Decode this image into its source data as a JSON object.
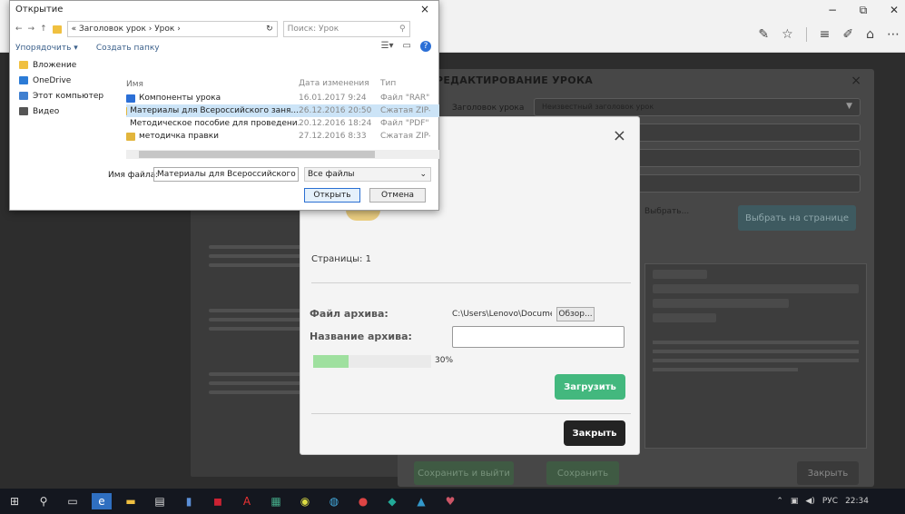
{
  "browser": {
    "win_min": "−",
    "win_restore": "⧉",
    "win_close": "✕"
  },
  "editor": {
    "title": "РЕДАКТИРОВАНИЕ УРОКА",
    "close": "×",
    "lesson_label": "Заголовок урока",
    "select_value": "Неизвестный заголовок урок",
    "choose_text": "Выбрать...",
    "choose_button": "Выбрать на странице",
    "btn_save": "Сохранить и выйти",
    "btn_save2": "Сохранить",
    "btn_close": "Закрыть"
  },
  "modal": {
    "close": "×",
    "pages": "Страницы: 1",
    "file_label": "Файл архива:",
    "file_path": "C:\\Users\\Lenovo\\Docume",
    "browse": "Обзор...",
    "name_label": "Название архива:",
    "name_value": "",
    "progress_percent": 30,
    "progress_text": "30%",
    "upload": "Загрузить",
    "close_button": "Закрыть"
  },
  "file_dialog": {
    "title": "Открытие",
    "close": "×",
    "path": "« Заголовок урок › Урок ›",
    "search_placeholder": "Поиск: Урок",
    "organize": "Упорядочить ▾",
    "new_folder": "Создать папку",
    "sidebar": [
      {
        "label": "Вложение",
        "color": "#f0c040"
      },
      {
        "label": "OneDrive",
        "color": "#2b7bd6"
      },
      {
        "label": "Этот компьютер",
        "color": "#3f7fd0"
      },
      {
        "label": "Видео",
        "color": "#555555"
      }
    ],
    "columns": [
      "Имя",
      "Дата изменения",
      "Тип"
    ],
    "rows": [
      {
        "name": "Компоненты урока",
        "date": "16.01.2017 9:24",
        "type": "Файл \"RAR\"",
        "color": "#2b6fd6",
        "selected": false
      },
      {
        "name": "Материалы для Всероссийского заня...",
        "date": "26.12.2016 20:50",
        "type": "Сжатая ZIP-п",
        "color": "#e2b53c",
        "selected": true
      },
      {
        "name": "Методическое пособие для проведени...",
        "date": "20.12.2016 18:24",
        "type": "Файл \"PDF\"",
        "color": "#8a8a8a",
        "selected": false
      },
      {
        "name": "методичка правки",
        "date": "27.12.2016 8:33",
        "type": "Сжатая ZIP-п",
        "color": "#e2b53c",
        "selected": false
      }
    ],
    "filename_label": "Имя файла:",
    "filename": "Материалы для Всероссийского заня",
    "filetype": "Все файлы",
    "open": "Открыть",
    "cancel": "Отмена"
  },
  "taskbar": {
    "icons": [
      "windows-start",
      "search",
      "task-view",
      "edge",
      "file-explorer",
      "store",
      "word",
      "app",
      "acrobat",
      "calculator",
      "chrome",
      "app2",
      "app3",
      "app4",
      "app5",
      "app6"
    ],
    "tray_lang": "РУС",
    "tray_time": "22:34"
  }
}
